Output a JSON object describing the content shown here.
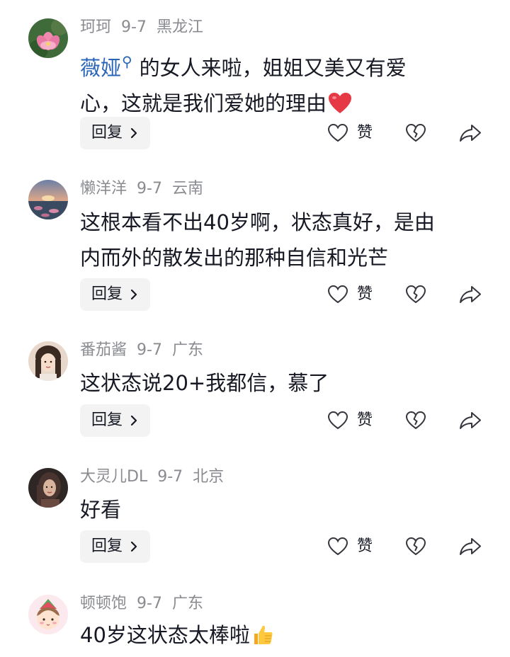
{
  "comments": [
    {
      "username": "珂珂",
      "date": "9-7",
      "location": "黑龙江",
      "mention": "薇娅",
      "text_after_mention": "的女人来啦，姐姐又美又有爱",
      "text_line2": "心，这就是我们爱她的理由",
      "emoji": "heart-emoji",
      "reply_label": "回复",
      "like_label": "赞"
    },
    {
      "username": "懒洋洋",
      "date": "9-7",
      "location": "云南",
      "text_line1": "这根本看不出40岁啊，状态真好，是由",
      "text_line2": "内而外的散发出的那种自信和光芒",
      "reply_label": "回复",
      "like_label": "赞"
    },
    {
      "username": "番茄酱",
      "date": "9-7",
      "location": "广东",
      "text_line1": "这状态说20+我都信，慕了",
      "reply_label": "回复",
      "like_label": "赞"
    },
    {
      "username": "大灵儿DL",
      "date": "9-7",
      "location": "北京",
      "text_line1": "好看",
      "reply_label": "回复",
      "like_label": "赞"
    },
    {
      "username": "顿顿饱",
      "date": "9-7",
      "location": "广东",
      "text_line1": "40岁这状态太棒啦",
      "emoji": "thumbs-up-emoji"
    }
  ]
}
